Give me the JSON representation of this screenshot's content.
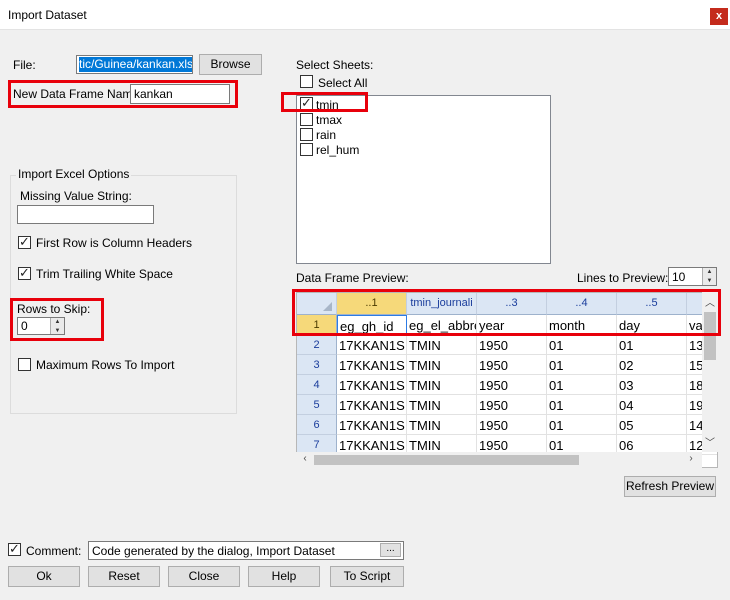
{
  "window": {
    "title": "Import Dataset",
    "close_glyph": "x"
  },
  "file": {
    "label": "File:",
    "value": "tic/Guinea/kankan.xlsx",
    "browse_label": "Browse"
  },
  "data_frame_name": {
    "label": "New Data Frame Name:",
    "value": "kankan"
  },
  "import_options": {
    "group_title": "Import Excel Options",
    "missing_value_label": "Missing Value String:",
    "missing_value": "",
    "first_row_headers": {
      "label": "First Row is Column Headers",
      "checked": true
    },
    "trim_whitespace": {
      "label": "Trim Trailing White Space",
      "checked": true
    },
    "rows_to_skip": {
      "label": "Rows to Skip:",
      "value": "0"
    },
    "max_rows": {
      "label": "Maximum Rows To Import",
      "checked": false
    }
  },
  "sheets": {
    "label": "Select Sheets:",
    "select_all": {
      "label": "Select All",
      "checked": false
    },
    "items": [
      {
        "label": "tmin",
        "checked": true
      },
      {
        "label": "tmax",
        "checked": false
      },
      {
        "label": "rain",
        "checked": false
      },
      {
        "label": "rel_hum",
        "checked": false
      }
    ]
  },
  "preview": {
    "label": "Data Frame Preview:",
    "lines_label": "Lines to Preview:",
    "lines_value": "10",
    "columns": [
      "..1",
      "tmin_journali",
      "..3",
      "..4",
      "..5",
      ""
    ],
    "row_numbers": [
      "1",
      "2",
      "3",
      "4",
      "5",
      "6",
      "7"
    ],
    "rows": [
      [
        "eg_gh_id",
        "eg_el_abbre",
        "year",
        "month",
        "day",
        "va"
      ],
      [
        "17KKAN1S",
        "TMIN",
        "1950",
        "01",
        "01",
        "13"
      ],
      [
        "17KKAN1S",
        "TMIN",
        "1950",
        "01",
        "02",
        "15"
      ],
      [
        "17KKAN1S",
        "TMIN",
        "1950",
        "01",
        "03",
        "18"
      ],
      [
        "17KKAN1S",
        "TMIN",
        "1950",
        "01",
        "04",
        "19"
      ],
      [
        "17KKAN1S",
        "TMIN",
        "1950",
        "01",
        "05",
        "14"
      ],
      [
        "17KKAN1S",
        "TMIN",
        "1950",
        "01",
        "06",
        "12"
      ]
    ],
    "refresh_label": "Refresh Preview"
  },
  "comment": {
    "label": "Comment:",
    "checked": true,
    "value": "Code generated by the dialog, Import Dataset",
    "more_label": "..."
  },
  "buttons": {
    "ok": "Ok",
    "reset": "Reset",
    "close": "Close",
    "help": "Help",
    "to_script": "To Script"
  },
  "colors": {
    "highlight": "#e8000b",
    "header_bg": "#dbe6f4",
    "active_header": "#f6d97a",
    "file_selection": "#0078d7"
  }
}
